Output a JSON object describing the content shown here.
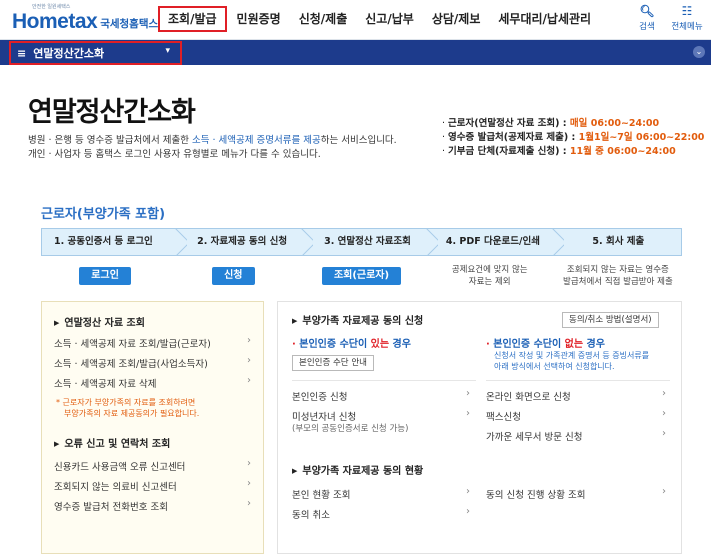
{
  "header": {
    "logo_tagline": "안전한 일원세택스",
    "logo_text": "Hometax",
    "logo_sub": "국세청홈택스",
    "nav": [
      "조회/발급",
      "민원증명",
      "신청/제출",
      "신고/납부",
      "상담/제보",
      "세무대리/납세관리"
    ],
    "tools": [
      {
        "icon": "search-icon",
        "label": "검색"
      },
      {
        "icon": "grid-menu-icon",
        "label": "전체메뉴"
      }
    ]
  },
  "subnav": {
    "menu_label": "연말정산간소화"
  },
  "page": {
    "title": "연말정산간소화",
    "intro_1a": "병원 · 은행 등 영수증 발급처에서 제출한 ",
    "intro_1b": "소득 · 세액공제 증명서류를 제공",
    "intro_1c": "하는 서비스입니다.",
    "intro_2": "개인 · 사업자 등 홈택스 로그인 사용자 유형별로 메뉴가 다를 수 있습니다.",
    "hours": [
      {
        "label": "근로자(연말정산 자료 조회) : ",
        "when": "매일 ",
        "time": "06:00~24:00"
      },
      {
        "label": "영수증 발급처(공제자료 제출) : ",
        "when": "1월1일~7일 ",
        "time": "06:00~22:00"
      },
      {
        "label": "기부금 단체(자료제출 신청) : ",
        "when": "11월 중 ",
        "time": "06:00~24:00"
      }
    ]
  },
  "section": {
    "title": "근로자(부양가족 포함)",
    "steps": [
      "1. 공동인증서 등 로그인",
      "2. 자료제공 동의 신청",
      "3. 연말정산 자료조회",
      "4. PDF 다운로드/인쇄",
      "5. 회사 제출"
    ],
    "step_buttons": [
      "로그인",
      "신청",
      "조회(근로자)"
    ],
    "step4_note_1": "공제요건에 맞지 않는",
    "step4_note_2": "자료는 제외",
    "step5_note_1": "조회되지 않는 자료는 영수증",
    "step5_note_2": "발급처에서 직접 발급받아 제출"
  },
  "left_box": {
    "heading1": "연말정산 자료 조회",
    "links1": [
      "소득 · 세액공제 자료 조회/발급(근로자)",
      "소득 · 세액공제 조회/발급(사업소득자)",
      "소득 · 세액공제 자료 삭제"
    ],
    "note_1": "* 근로자가 부양가족의 자료를 조회하려면",
    "note_2": "부양가족의 자료 제공동의가 필요합니다.",
    "heading2": "오류 신고 및 연락처 조회",
    "links2": [
      "신용카드 사용금액 오류 신고센터",
      "조회되지 않는 의료비 신고센터",
      "영수증 발급처 전화번호 조회"
    ]
  },
  "right_box": {
    "heading1": "부양가족 자료제공 동의 신청",
    "help_button": "동의/취소 방법(설명서)",
    "col1_title_a": "본인인증 수단이 ",
    "col1_title_b": "있는",
    "col1_title_c": " 경우",
    "col1_button": "본인인증 수단 안내",
    "col2_title_a": "본인인증 수단이 ",
    "col2_title_b": "없는",
    "col2_title_c": " 경우",
    "col2_desc_1": "신청서 작성 및 가족관계 증명서 등 증빙서류를",
    "col2_desc_2": "아래 방식에서 선택하여 신청합니다.",
    "col1_links": [
      "본인인증 신청",
      "미성년자녀 신청"
    ],
    "col1_sub": "(부모의 공동인증서로 신청 가능)",
    "col2_links": [
      "온라인 화면으로 신청",
      "팩스신청",
      "가까운 세무서 방문 신청"
    ],
    "heading2": "부양가족 자료제공 동의 현황",
    "status_links_left": [
      "본인 현황 조회",
      "동의 취소"
    ],
    "status_links_right": [
      "동의 신청 진행 상황 조회"
    ]
  }
}
